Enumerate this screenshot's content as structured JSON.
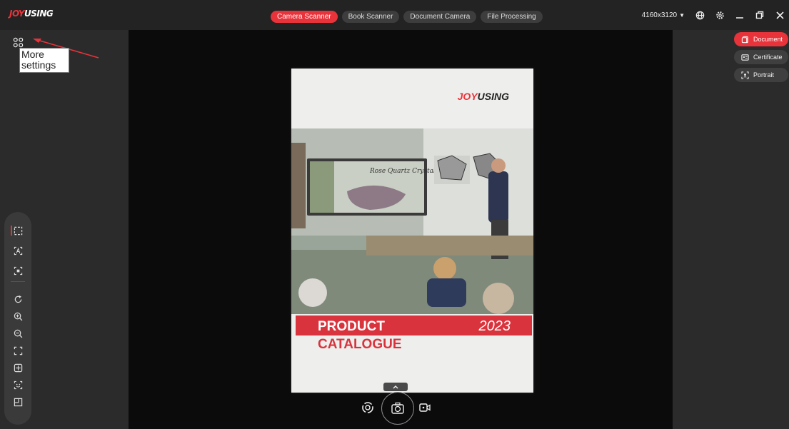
{
  "app": {
    "logo": "JOYUSING"
  },
  "tabs": [
    {
      "label": "Camera Scanner",
      "active": true
    },
    {
      "label": "Book Scanner",
      "active": false
    },
    {
      "label": "Document Camera",
      "active": false
    },
    {
      "label": "File Processing",
      "active": false
    }
  ],
  "toolbar_right": {
    "resolution": "4160x3120"
  },
  "left": {
    "tooltip": "More settings"
  },
  "modes": [
    {
      "label": "Document",
      "icon": "document-icon",
      "active": true
    },
    {
      "label": "Certificate",
      "icon": "certificate-icon",
      "active": false
    },
    {
      "label": "Portrait",
      "icon": "portrait-icon",
      "active": false
    }
  ],
  "document_preview": {
    "brand": "JOYUSING",
    "board_text": "Rose Quartz Crystal",
    "title_line1": "PRODUCT",
    "title_line2": "CATALOGUE",
    "year": "2023"
  },
  "colors": {
    "accent": "#e8333b",
    "background": "#2b2b2b",
    "viewport": "#0b0b0c"
  }
}
